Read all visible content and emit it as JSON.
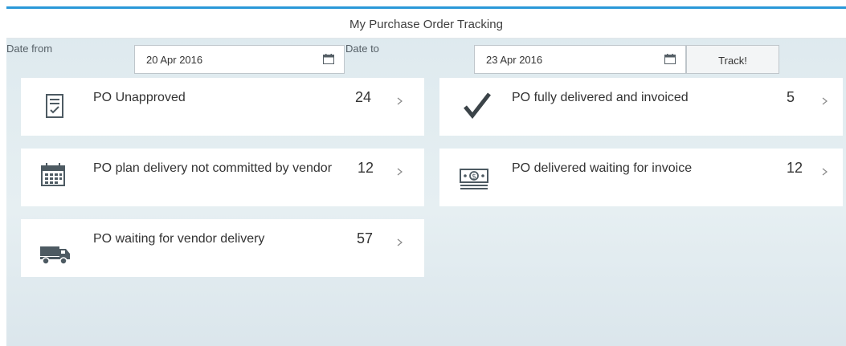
{
  "header": {
    "title": "My Purchase Order Tracking"
  },
  "filters": {
    "date_from_label": "Date from",
    "date_from_value": "20 Apr 2016",
    "date_to_label": "Date to",
    "date_to_value": "23 Apr 2016",
    "track_label": "Track!"
  },
  "tiles": [
    {
      "label": "PO Unapproved",
      "count": "24",
      "icon": "checklist-icon"
    },
    {
      "label": "PO fully delivered and invoiced",
      "count": "5",
      "icon": "checkmark-icon"
    },
    {
      "label": "PO plan delivery not committed by vendor",
      "count": "12",
      "icon": "calendar-icon"
    },
    {
      "label": "PO delivered waiting for invoice",
      "count": "12",
      "icon": "money-icon"
    },
    {
      "label": "PO waiting for vendor delivery",
      "count": "57",
      "icon": "truck-icon"
    }
  ],
  "colors": {
    "accent": "#2a98d8",
    "background": "#e4edf1",
    "tile": "#ffffff",
    "icon": "#555f66"
  }
}
